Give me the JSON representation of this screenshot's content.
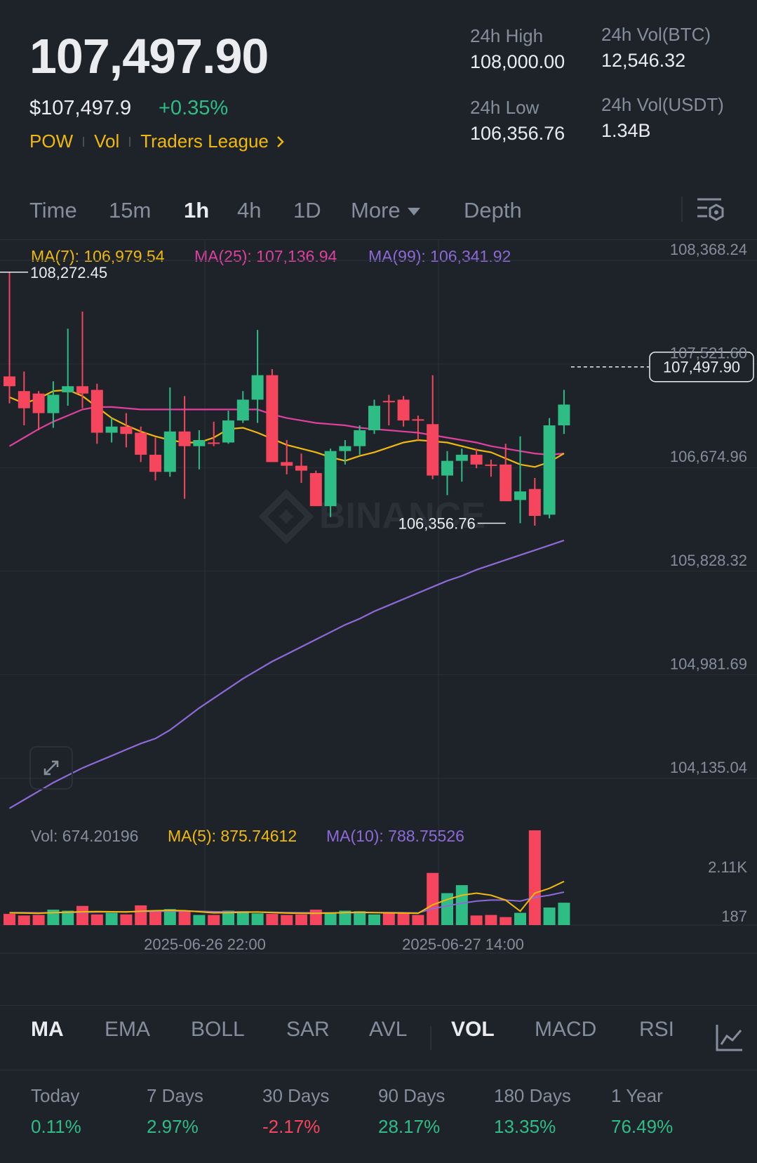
{
  "header": {
    "last_price": "107,497.90",
    "usd_price": "$107,497.9",
    "change_pct": "+0.35%",
    "tags": [
      "POW",
      "Vol",
      "Traders League"
    ],
    "stats": {
      "high_label": "24h High",
      "high_value": "108,000.00",
      "low_label": "24h Low",
      "low_value": "106,356.76",
      "vol_btc_label": "24h Vol(BTC)",
      "vol_btc_value": "12,546.32",
      "vol_usdt_label": "24h Vol(USDT)",
      "vol_usdt_value": "1.34B"
    }
  },
  "timeframes": [
    {
      "label": "Time",
      "active": false
    },
    {
      "label": "15m",
      "active": false
    },
    {
      "label": "1h",
      "active": true
    },
    {
      "label": "4h",
      "active": false
    },
    {
      "label": "1D",
      "active": false
    },
    {
      "label": "More",
      "active": false
    },
    {
      "label": "Depth",
      "active": false
    }
  ],
  "ma_legend": {
    "ma7": "MA(7): 106,979.54",
    "ma25": "MA(25): 107,136.94",
    "ma99": "MA(99): 106,341.92"
  },
  "vol_legend": {
    "vol": "Vol: 674.20196",
    "ma5": "MA(5): 875.74612",
    "ma10": "MA(10): 788.75526"
  },
  "watermark": "BINANCE",
  "indicators": {
    "main": [
      {
        "label": "MA",
        "active": true
      },
      {
        "label": "EMA",
        "active": false
      },
      {
        "label": "BOLL",
        "active": false
      },
      {
        "label": "SAR",
        "active": false
      },
      {
        "label": "AVL",
        "active": false
      }
    ],
    "sub": [
      {
        "label": "VOL",
        "active": true
      },
      {
        "label": "MACD",
        "active": false
      },
      {
        "label": "RSI",
        "active": false
      }
    ]
  },
  "performance": [
    {
      "label": "Today",
      "value": "0.11%",
      "dir": "up"
    },
    {
      "label": "7 Days",
      "value": "2.97%",
      "dir": "up"
    },
    {
      "label": "30 Days",
      "value": "-2.17%",
      "dir": "down"
    },
    {
      "label": "90 Days",
      "value": "28.17%",
      "dir": "up"
    },
    {
      "label": "180 Days",
      "value": "13.35%",
      "dir": "up"
    },
    {
      "label": "1 Year",
      "value": "76.49%",
      "dir": "up"
    }
  ],
  "colors": {
    "up": "#2ebd85",
    "down": "#f6465d",
    "ma7": "#f0b90b",
    "ma25": "#e040a0",
    "ma99": "#8e6ad8",
    "bg": "#1e2329"
  },
  "chart_data": {
    "type": "candlestick",
    "price_axis": {
      "ticks": [
        "108,368.24",
        "107,521.60",
        "106,674.96",
        "105,828.32",
        "104,981.69",
        "104,135.04"
      ],
      "ylim": [
        104135.04,
        108368.24
      ]
    },
    "volume_axis": {
      "ticks": [
        "2.11K",
        "187"
      ]
    },
    "x_ticks": [
      "2025-06-26 22:00",
      "2025-06-27 14:00"
    ],
    "high_marker": "108,272.45",
    "low_marker": "106,356.76",
    "current_price_label": "107,497.90",
    "candles": [
      {
        "o": 107420,
        "h": 108272,
        "l": 107200,
        "c": 107340
      },
      {
        "o": 107300,
        "h": 107460,
        "l": 107020,
        "c": 107160
      },
      {
        "o": 107280,
        "h": 107300,
        "l": 106980,
        "c": 107120
      },
      {
        "o": 107120,
        "h": 107380,
        "l": 107000,
        "c": 107270
      },
      {
        "o": 107290,
        "h": 107810,
        "l": 107180,
        "c": 107340
      },
      {
        "o": 107340,
        "h": 107950,
        "l": 107160,
        "c": 107280
      },
      {
        "o": 107310,
        "h": 107360,
        "l": 106870,
        "c": 106960
      },
      {
        "o": 106960,
        "h": 107080,
        "l": 106880,
        "c": 107010
      },
      {
        "o": 107010,
        "h": 107120,
        "l": 106840,
        "c": 106950
      },
      {
        "o": 106960,
        "h": 107010,
        "l": 106720,
        "c": 106780
      },
      {
        "o": 106780,
        "h": 106920,
        "l": 106570,
        "c": 106640
      },
      {
        "o": 106640,
        "h": 107330,
        "l": 106600,
        "c": 106970
      },
      {
        "o": 106970,
        "h": 107260,
        "l": 106420,
        "c": 106850
      },
      {
        "o": 106850,
        "h": 106980,
        "l": 106660,
        "c": 106900
      },
      {
        "o": 106880,
        "h": 107050,
        "l": 106850,
        "c": 106870
      },
      {
        "o": 106880,
        "h": 107140,
        "l": 106870,
        "c": 107060
      },
      {
        "o": 107060,
        "h": 107300,
        "l": 107040,
        "c": 107230
      },
      {
        "o": 107230,
        "h": 107800,
        "l": 107040,
        "c": 107430
      },
      {
        "o": 107430,
        "h": 107480,
        "l": 106740,
        "c": 106720
      },
      {
        "o": 106720,
        "h": 106900,
        "l": 106620,
        "c": 106690
      },
      {
        "o": 106690,
        "h": 106790,
        "l": 106550,
        "c": 106650
      },
      {
        "o": 106630,
        "h": 106650,
        "l": 106360,
        "c": 106360
      },
      {
        "o": 106360,
        "h": 106830,
        "l": 106270,
        "c": 106810
      },
      {
        "o": 106810,
        "h": 106900,
        "l": 106700,
        "c": 106850
      },
      {
        "o": 106850,
        "h": 107020,
        "l": 106780,
        "c": 106980
      },
      {
        "o": 106980,
        "h": 107230,
        "l": 106950,
        "c": 107180
      },
      {
        "o": 107220,
        "h": 107270,
        "l": 107020,
        "c": 107210
      },
      {
        "o": 107230,
        "h": 107260,
        "l": 107010,
        "c": 107060
      },
      {
        "o": 107070,
        "h": 107100,
        "l": 106900,
        "c": 107060
      },
      {
        "o": 107030,
        "h": 107430,
        "l": 106580,
        "c": 106610
      },
      {
        "o": 106610,
        "h": 106810,
        "l": 106450,
        "c": 106730
      },
      {
        "o": 106730,
        "h": 106830,
        "l": 106560,
        "c": 106780
      },
      {
        "o": 106780,
        "h": 106830,
        "l": 106670,
        "c": 106700
      },
      {
        "o": 106700,
        "h": 106740,
        "l": 106600,
        "c": 106690
      },
      {
        "o": 106700,
        "h": 106870,
        "l": 106400,
        "c": 106400
      },
      {
        "o": 106410,
        "h": 106930,
        "l": 106220,
        "c": 106480
      },
      {
        "o": 106500,
        "h": 106590,
        "l": 106200,
        "c": 106280
      },
      {
        "o": 106290,
        "h": 107080,
        "l": 106260,
        "c": 107020
      },
      {
        "o": 107020,
        "h": 107310,
        "l": 106950,
        "c": 107190
      }
    ],
    "volumes": [
      210,
      180,
      190,
      290,
      270,
      360,
      200,
      230,
      200,
      370,
      250,
      300,
      250,
      190,
      190,
      270,
      260,
      220,
      210,
      190,
      200,
      290,
      240,
      270,
      260,
      200,
      220,
      220,
      190,
      980,
      600,
      750,
      180,
      190,
      150,
      230,
      1780,
      330,
      420
    ],
    "ma7": [
      107250,
      107200,
      107240,
      107300,
      107310,
      107260,
      107170,
      107080,
      107020,
      106970,
      106930,
      106900,
      106880,
      106880,
      106920,
      106990,
      107000,
      106960,
      106910,
      106860,
      106830,
      106800,
      106760,
      106730,
      106770,
      106800,
      106840,
      106880,
      106900,
      106890,
      106880,
      106850,
      106820,
      106800,
      106750,
      106700,
      106680,
      106720,
      106790
    ],
    "ma25": [
      106850,
      106920,
      106990,
      107050,
      107100,
      107150,
      107170,
      107170,
      107160,
      107150,
      107150,
      107150,
      107150,
      107150,
      107150,
      107150,
      107150,
      107150,
      107110,
      107080,
      107060,
      107040,
      107030,
      107020,
      107000,
      106990,
      106980,
      106970,
      106960,
      106940,
      106920,
      106900,
      106880,
      106850,
      106830,
      106810,
      106790,
      106780,
      106790
    ],
    "ma99": [
      103890,
      103960,
      104030,
      104100,
      104160,
      104220,
      104270,
      104320,
      104370,
      104420,
      104460,
      104530,
      104620,
      104710,
      104790,
      104870,
      104950,
      105020,
      105090,
      105150,
      105210,
      105270,
      105330,
      105390,
      105440,
      105500,
      105550,
      105600,
      105650,
      105700,
      105750,
      105790,
      105840,
      105880,
      105920,
      105960,
      106000,
      106040,
      106080
    ],
    "vol_ma5": [
      230,
      225,
      220,
      235,
      240,
      250,
      255,
      250,
      245,
      260,
      270,
      275,
      270,
      250,
      230,
      235,
      240,
      245,
      235,
      225,
      220,
      220,
      225,
      235,
      240,
      235,
      230,
      225,
      220,
      380,
      480,
      560,
      600,
      560,
      470,
      260,
      600,
      690,
      820
    ],
    "vol_ma10": [
      235,
      235,
      230,
      235,
      238,
      240,
      245,
      248,
      250,
      255,
      258,
      262,
      262,
      258,
      250,
      248,
      246,
      244,
      240,
      235,
      232,
      230,
      230,
      232,
      234,
      235,
      235,
      232,
      228,
      310,
      360,
      410,
      450,
      470,
      470,
      450,
      520,
      560,
      620
    ]
  }
}
